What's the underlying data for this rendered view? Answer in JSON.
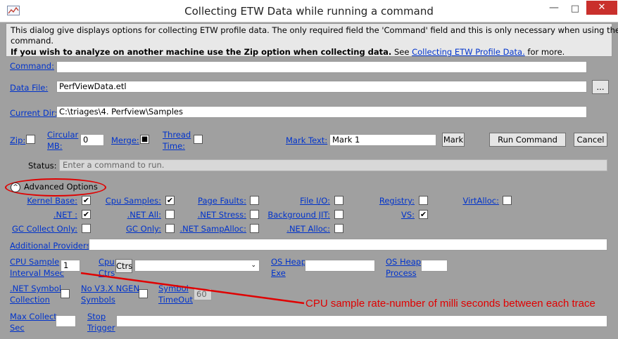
{
  "window": {
    "title": "Collecting ETW Data while running a command",
    "minimize_glyph": "—",
    "maximize_glyph": "□",
    "close_glyph": "✕"
  },
  "info": {
    "line1": "This dialog give displays options for collecting ETW profile data. The only required field the 'Command' field and this is only necessary when using the 'Run'",
    "line2": "command.",
    "line3_bold": "If you wish to analyze on another machine use the Zip option when collecting data.",
    "line3_see": "See",
    "line3_link": "Collecting ETW Profile Data.",
    "line3_tail": "for more."
  },
  "fields": {
    "command_label": "Command:",
    "command_value": "",
    "data_file_label": "Data File:",
    "data_file_value": "PerfViewData.etl",
    "browse_label": "...",
    "current_dir_label": "Current Dir:",
    "current_dir_value": "C:\\triages\\4. Perfview\\Samples"
  },
  "options_row": {
    "zip_label": "Zip:",
    "zip_checked": "",
    "circular_label_1": "Circular",
    "circular_label_2": "MB:",
    "circular_value": "0",
    "merge_label": "Merge:",
    "merge_checked": "■",
    "thread_time_label_1": "Thread",
    "thread_time_label_2": "Time:",
    "thread_time_checked": "",
    "mark_text_label": "Mark Text:",
    "mark_text_value": "Mark 1",
    "mark_button": "Mark",
    "run_button": "Run Command",
    "cancel_button": "Cancel"
  },
  "status": {
    "label": "Status:",
    "value": "Enter a command to run."
  },
  "advanced": {
    "chevron": "^",
    "label": "Advanced Options",
    "row1": [
      {
        "label": "Kernel Base:",
        "checked": "✔"
      },
      {
        "label": "Cpu Samples:",
        "checked": "✔"
      },
      {
        "label": "Page Faults:",
        "checked": ""
      },
      {
        "label": "File I/O:",
        "checked": ""
      },
      {
        "label": "Registry:",
        "checked": ""
      },
      {
        "label": "VirtAlloc:",
        "checked": ""
      }
    ],
    "row2": [
      {
        "label": ".NET :",
        "checked": "✔"
      },
      {
        "label": ".NET All:",
        "checked": ""
      },
      {
        "label": ".NET Stress:",
        "checked": ""
      },
      {
        "label": "Background JIT:",
        "checked": ""
      },
      {
        "label": "VS:",
        "checked": "✔"
      }
    ],
    "row3": [
      {
        "label": "GC Collect Only:",
        "checked": ""
      },
      {
        "label": "GC Only:",
        "checked": ""
      },
      {
        "label": ".NET SampAlloc:",
        "checked": ""
      },
      {
        "label": ".NET Alloc:",
        "checked": ""
      }
    ],
    "additional_providers_label": "Additional Providers:",
    "additional_providers_value": "",
    "cpu_sample_label_1": "CPU Sample",
    "cpu_sample_label_2": "Interval Msec",
    "cpu_sample_value": "1",
    "cpu_ctrs_label_1": "Cpu",
    "cpu_ctrs_label_2": "Ctrs",
    "cpu_ctrs_button": "Ctrs",
    "cpu_ctrs_select_value": "",
    "os_heap_exe_label_1": "OS Heap",
    "os_heap_exe_label_2": "Exe",
    "os_heap_exe_value": "",
    "os_heap_process_label_1": "OS Heap",
    "os_heap_process_label_2": "Process",
    "os_heap_process_value": "",
    "net_symbol_label_1": ".NET Symbol",
    "net_symbol_label_2": "Collection",
    "net_symbol_checked": "",
    "no_v3x_label_1": "No V3.X NGEN",
    "no_v3x_label_2": "Symbols",
    "no_v3x_checked": "",
    "symbol_timeout_label_1": "Symbol",
    "symbol_timeout_label_2": "TimeOut",
    "symbol_timeout_value": "60",
    "max_collect_label_1": "Max Collect",
    "max_collect_label_2": "Sec",
    "max_collect_value": "",
    "stop_trigger_label_1": "Stop",
    "stop_trigger_label_2": "Trigger",
    "stop_trigger_value": ""
  },
  "annotation": {
    "text": "CPU sample rate-number of milli seconds between each trace",
    "color": "#e00000"
  },
  "colors": {
    "link": "#0033cc",
    "background": "#a0a0a0",
    "close_button": "#c9302c"
  }
}
